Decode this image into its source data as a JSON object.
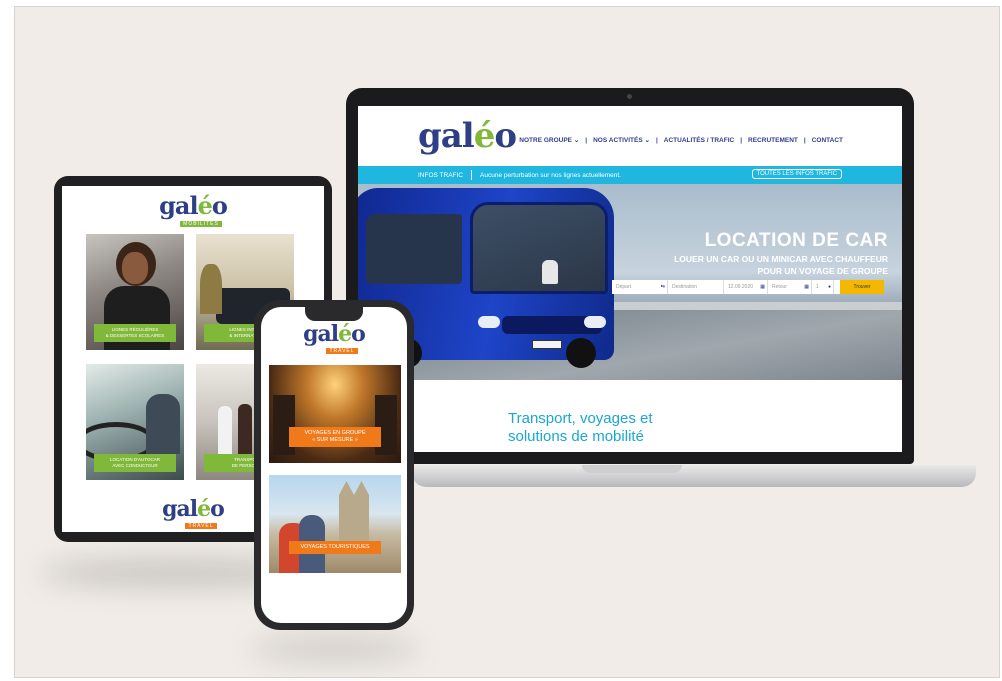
{
  "laptop": {
    "logo": {
      "pre": "gal",
      "accent": "é",
      "post": "o"
    },
    "nav": [
      "NOTRE GROUPE ⌄",
      "|",
      "NOS ACTIVITÉS ⌄",
      "|",
      "ACTUALITÉS / TRAFIC",
      "|",
      "RECRUTEMENT",
      "|",
      "CONTACT"
    ],
    "traffic_bar": {
      "label": "INFOS TRAFIC",
      "message": "Aucune perturbation sur nos lignes actuellement.",
      "button": "TOUTES LES INFOS TRAFIC"
    },
    "hero": {
      "title": "LOCATION DE CAR",
      "subtitle_line1": "LOUER UN CAR OU UN MINICAR AVEC CHAUFFEUR",
      "subtitle_line2": "POUR UN VOYAGE DE GROUPE"
    },
    "search": {
      "depart": "Départ",
      "destination": "Destination",
      "date": "12.09.2020",
      "retour": "Retour",
      "passengers": "1",
      "submit": "Trouver"
    },
    "subtitle_line1": "Transport, voyages et",
    "subtitle_line2": "solutions de mobilité"
  },
  "tablet": {
    "logo": {
      "pre": "gal",
      "accent": "é",
      "post": "o",
      "tag": "MOBILITÉS"
    },
    "tiles": [
      {
        "label_line1": "LIGNES RÉGULIÈRES",
        "label_line2": "& DESSERTES SCOLAIRES"
      },
      {
        "label_line1": "LIGNES INTER",
        "label_line2": "& INTERNATIO"
      },
      {
        "label_line1": "LOCATION D'AUTOCAR",
        "label_line2": "AVEC CONDUCTEUR"
      },
      {
        "label_line1": "TRANSPO",
        "label_line2": "DE PERSON"
      }
    ],
    "footer_logo": {
      "pre": "gal",
      "accent": "é",
      "post": "o",
      "tag": "TRAVEL"
    }
  },
  "phone": {
    "logo": {
      "pre": "gal",
      "accent": "é",
      "post": "o",
      "tag": "TRAVEL"
    },
    "cards": [
      {
        "line1": "VOYAGES EN GROUPE",
        "line2": "« SUR MESURE »"
      },
      {
        "line1": "VOYAGES TOURISTIQUES",
        "line2": ""
      }
    ]
  },
  "colors": {
    "brand_blue": "#2e3f86",
    "brand_green": "#80b83a",
    "info_bar": "#1fb7df",
    "cta_orange": "#f07a1a",
    "search_yellow": "#f5b800"
  }
}
